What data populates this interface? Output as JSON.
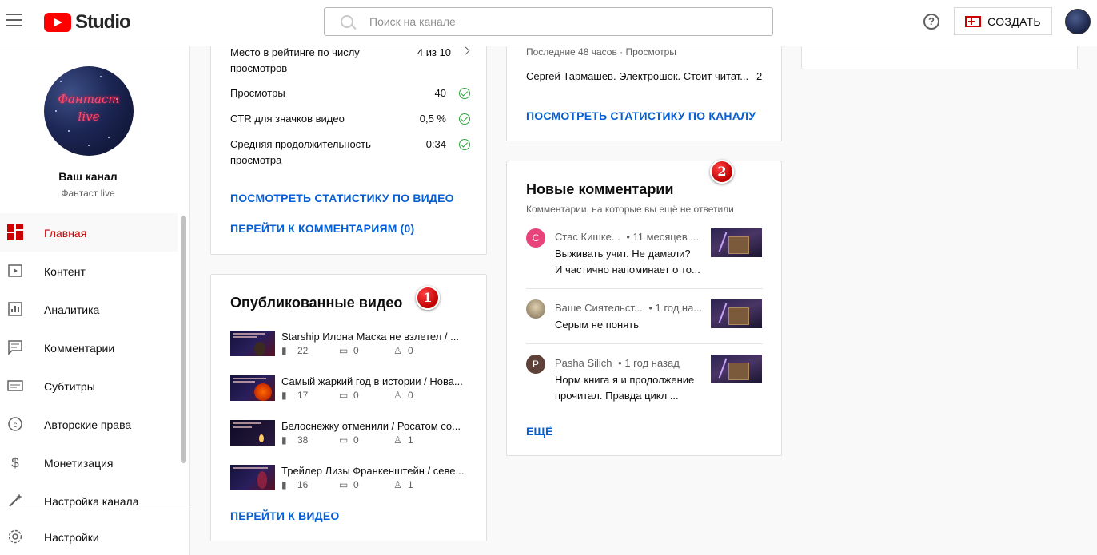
{
  "header": {
    "logo_text": "Studio",
    "search_placeholder": "Поиск на канале",
    "help_label": "?",
    "create_label": "СОЗДАТЬ"
  },
  "sidebar": {
    "channel_title": "Ваш канал",
    "channel_name": "Фантаст live",
    "channel_logo_text": "Фантаст live",
    "items": [
      {
        "label": "Главная",
        "icon": "dashboard-icon",
        "active": true
      },
      {
        "label": "Контент",
        "icon": "content-icon"
      },
      {
        "label": "Аналитика",
        "icon": "analytics-icon"
      },
      {
        "label": "Комментарии",
        "icon": "comments-icon"
      },
      {
        "label": "Субтитры",
        "icon": "subtitles-icon"
      },
      {
        "label": "Авторские права",
        "icon": "copyright-icon"
      },
      {
        "label": "Монетизация",
        "icon": "monetization-icon"
      },
      {
        "label": "Настройка канала",
        "icon": "customization-icon"
      }
    ],
    "settings_label": "Настройки"
  },
  "video_stats_card": {
    "rows": [
      {
        "label": "Место в рейтинге по числу просмотров",
        "label_line1": "Место в рейтинге по числу",
        "label_line2": "просмотров",
        "value": "4 из 10"
      },
      {
        "label": "Просмотры",
        "value": "40"
      },
      {
        "label": "CTR для значков видео",
        "value": "0,5 %"
      },
      {
        "label": "Средняя продолжительность просмотра",
        "label_line1": "Средняя продолжительность",
        "label_line2": "просмотра",
        "value": "0:34"
      }
    ],
    "link_stats": "ПОСМОТРЕТЬ СТАТИСТИКУ ПО ВИДЕО",
    "link_comments": "ПЕРЕЙТИ К КОММЕНТАРИЯМ (0)"
  },
  "published_card": {
    "title": "Опубликованные видео",
    "marker": "1",
    "videos": [
      {
        "title": "Starship Илона Маска не взлетел / ...",
        "views": "22",
        "comments": "0",
        "likes": "0"
      },
      {
        "title": "Самый жаркий год в истории / Нова...",
        "views": "17",
        "comments": "0",
        "likes": "0"
      },
      {
        "title": "Белоснежку отменили / Росатом со...",
        "views": "38",
        "comments": "0",
        "likes": "1"
      },
      {
        "title": "Трейлер Лизы Франкенштейн / севе...",
        "views": "16",
        "comments": "0",
        "likes": "1"
      }
    ],
    "link": "ПЕРЕЙТИ К ВИДЕО"
  },
  "channel_analytics_card": {
    "subtitle": "Последние 48 часов · Просмотры",
    "top_item": "Сергей Тармашев. Электрошок. Стоит читат...",
    "top_value": "2",
    "link": "ПОСМОТРЕТЬ СТАТИСТИКУ ПО КАНАЛУ"
  },
  "comments_card": {
    "title": "Новые комментарии",
    "subtitle": "Комментарии, на которые вы ещё не ответили",
    "marker": "2",
    "comments": [
      {
        "avatar_letter": "С",
        "avatar_color": "#e8437a",
        "author": "Стас Кишке...",
        "time": "• 11 месяцев ...",
        "line1": "Выживать учит. Не дамали?",
        "line2": "И частично напоминает о то..."
      },
      {
        "avatar_letter": "",
        "avatar_color": "#c9b48a",
        "author": "Ваше Сиятельст...",
        "time": "• 1 год на...",
        "line1": "Серым не понять",
        "line2": ""
      },
      {
        "avatar_letter": "P",
        "avatar_color": "#5d4037",
        "author": "Pasha Silich",
        "time": "• 1 год назад",
        "line1": "Норм книга я и продолжение",
        "line2": "прочитал. Правда цикл ..."
      }
    ],
    "link": "ЕЩЁ"
  },
  "colors": {
    "accent_red": "#cc0000",
    "link_blue": "#065fd4",
    "check_green": "#2ba640"
  }
}
